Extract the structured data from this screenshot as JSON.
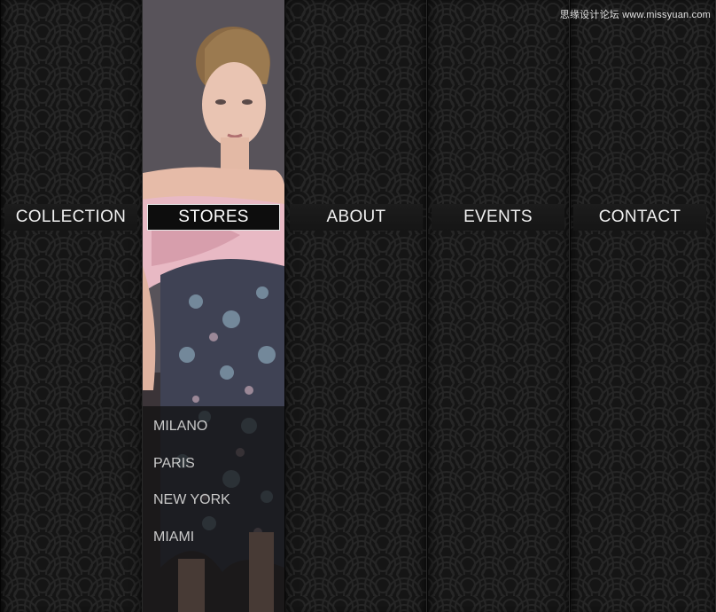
{
  "nav": {
    "items": [
      {
        "label": "COLLECTION"
      },
      {
        "label": "STORES"
      },
      {
        "label": "ABOUT"
      },
      {
        "label": "EVENTS"
      },
      {
        "label": "CONTACT"
      }
    ],
    "active_index": 1
  },
  "stores_menu": {
    "items": [
      {
        "label": "MILANO"
      },
      {
        "label": "PARIS"
      },
      {
        "label": "NEW YORK"
      },
      {
        "label": "MIAMI"
      }
    ]
  },
  "watermark": "思缘设计论坛 www.missyuan.com",
  "colors": {
    "background": "#141414",
    "nav_text": "#f0f0f0",
    "submenu_text": "#c9c9c9",
    "active_border": "#e8e8e8"
  }
}
